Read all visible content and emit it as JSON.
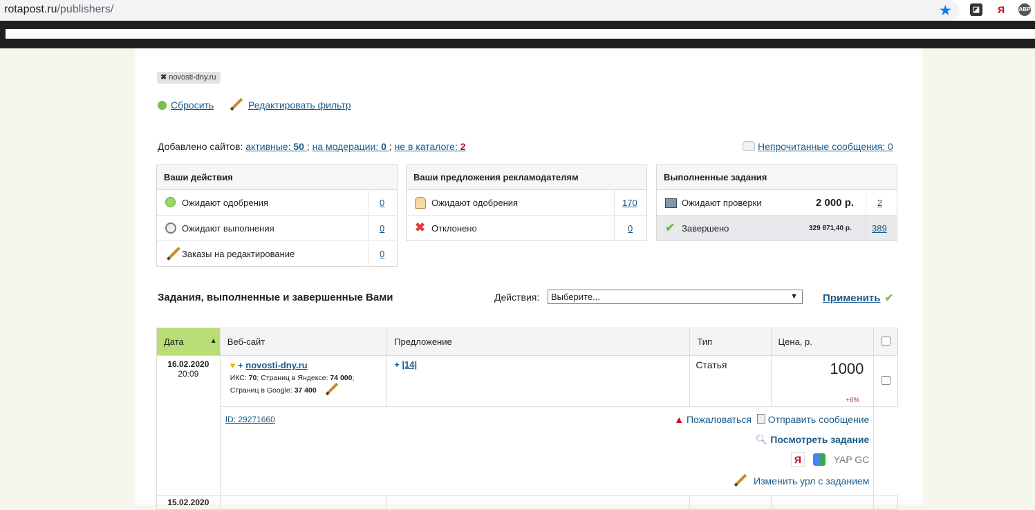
{
  "browser": {
    "url_host": "rotapost.ru",
    "url_path": "/publishers/",
    "ext_labels": [
      "Я",
      "ABP"
    ]
  },
  "filter": {
    "tag": "novosti-dny.ru",
    "reset": "Сбросить",
    "edit": "Редактировать фильтр"
  },
  "summary": {
    "prefix": "Добавлено сайтов:",
    "active_label": "активные:",
    "active_count": "50",
    "moderation_label": "на модерации:",
    "moderation_count": "0",
    "notincatalog_label": "не в каталоге:",
    "notincatalog_count": "2",
    "sep": ";",
    "messages": "Непрочитанные сообщения: 0"
  },
  "box1": {
    "title": "Ваши действия",
    "rows": [
      {
        "label": "Ожидают одобрения",
        "count": "0"
      },
      {
        "label": "Ожидают выполнения",
        "count": "0"
      },
      {
        "label": "Заказы на редактирование",
        "count": "0"
      }
    ]
  },
  "box2": {
    "title": "Ваши предложения рекламодателям",
    "rows": [
      {
        "label": "Ожидают одобрения",
        "count": "170"
      },
      {
        "label": "Отклонено",
        "count": "0"
      }
    ]
  },
  "box3": {
    "title": "Выполненные задания",
    "rows": [
      {
        "label": "Ожидают проверки",
        "amount": "2 000 р.",
        "count": "2"
      },
      {
        "label": "Завершено",
        "amount": "329 871,40 р.",
        "count": "389"
      }
    ]
  },
  "section": {
    "title": "Задания, выполненные и завершенные Вами",
    "actions_label": "Действия:",
    "select_value": "Выберите...",
    "apply": "Применить"
  },
  "table": {
    "headers": [
      "Дата",
      "Веб-сайт",
      "Предложение",
      "Тип",
      "Цена, р."
    ],
    "row1": {
      "date": "16.02.2020",
      "time": "20:09",
      "site_plus": "+",
      "site": "novosti-dny.ru",
      "iks_label": "ИКС:",
      "iks_value": "70",
      "yandex_label": "; Страниц в Яндексе:",
      "yandex_value": "74 000",
      "yandex_end": ";",
      "google_label": "Страниц в Google:",
      "google_value": "37 400",
      "offer_plus": "+",
      "offer": "|14|",
      "type": "Статья",
      "price": "1000",
      "change": "+6%",
      "id": "ID: 29271660",
      "complain": "Пожаловаться",
      "send": "Отправить сообщение",
      "view": "Посмотреть задание",
      "yandex_icon": "Я",
      "engines": "YAP GC",
      "change_url": "Изменить урл с заданием"
    },
    "row2_date": "15.02.2020"
  },
  "colors": {
    "link": "#1a5a8a",
    "date_header": "#b7dd74",
    "red": "#d0021b"
  }
}
